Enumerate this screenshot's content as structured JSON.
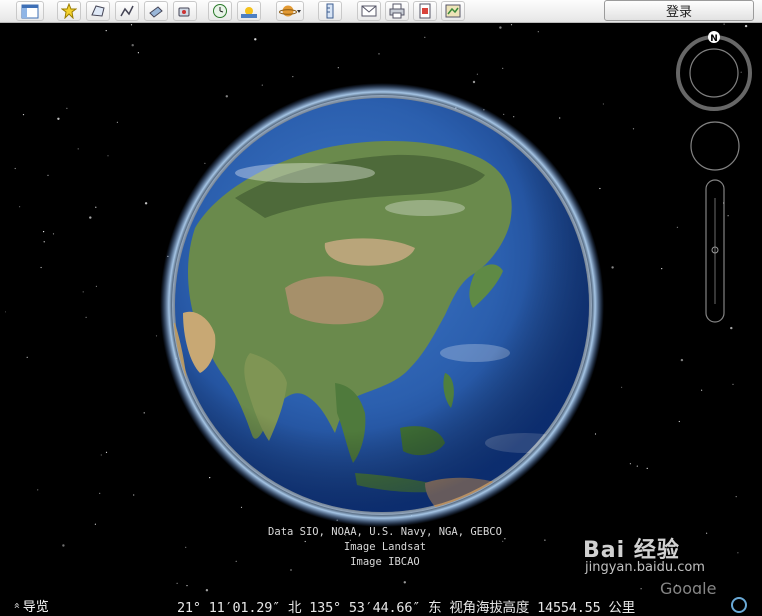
{
  "toolbar": {
    "buttons": [
      {
        "id": "sidebar-toggle",
        "icon": "sidebar-icon"
      },
      {
        "id": "add-placemark",
        "icon": "placemark-icon"
      },
      {
        "id": "add-polygon",
        "icon": "polygon-icon"
      },
      {
        "id": "add-path",
        "icon": "path-icon"
      },
      {
        "id": "add-image-overlay",
        "icon": "image-overlay-icon"
      },
      {
        "id": "record-tour",
        "icon": "record-tour-icon"
      },
      {
        "id": "historical-imagery",
        "icon": "clock-icon"
      },
      {
        "id": "sunlight",
        "icon": "sunlight-icon"
      },
      {
        "id": "switch-planet",
        "icon": "planet-icon"
      },
      {
        "id": "ruler",
        "icon": "ruler-icon"
      },
      {
        "id": "email",
        "icon": "email-icon"
      },
      {
        "id": "print",
        "icon": "print-icon"
      },
      {
        "id": "save-image",
        "icon": "save-image-icon"
      },
      {
        "id": "view-in-maps",
        "icon": "map-icon"
      }
    ],
    "login_label": "登录"
  },
  "navigation": {
    "north_label": "N"
  },
  "attribution": [
    "Data SIO, NOAA, U.S. Navy, NGA, GEBCO",
    "Image Landsat",
    "Image IBCAO"
  ],
  "statusbar": {
    "nav_label": "导览",
    "nav_chevron": "»",
    "coords_text": "21° 11′01.29″ 北 135° 53′44.66″ 东 视角海拔高度 14554.55 公里"
  },
  "watermark": {
    "brand": "Bai 经验",
    "url": "jingyan.baidu.com",
    "app_logo": "Google Earth"
  },
  "colors": {
    "ocean": "#2f63b0",
    "ocean_deep": "#173d86",
    "land": "#5b7a44",
    "atmosphere": "#a9d2ff",
    "space": "#000000"
  }
}
